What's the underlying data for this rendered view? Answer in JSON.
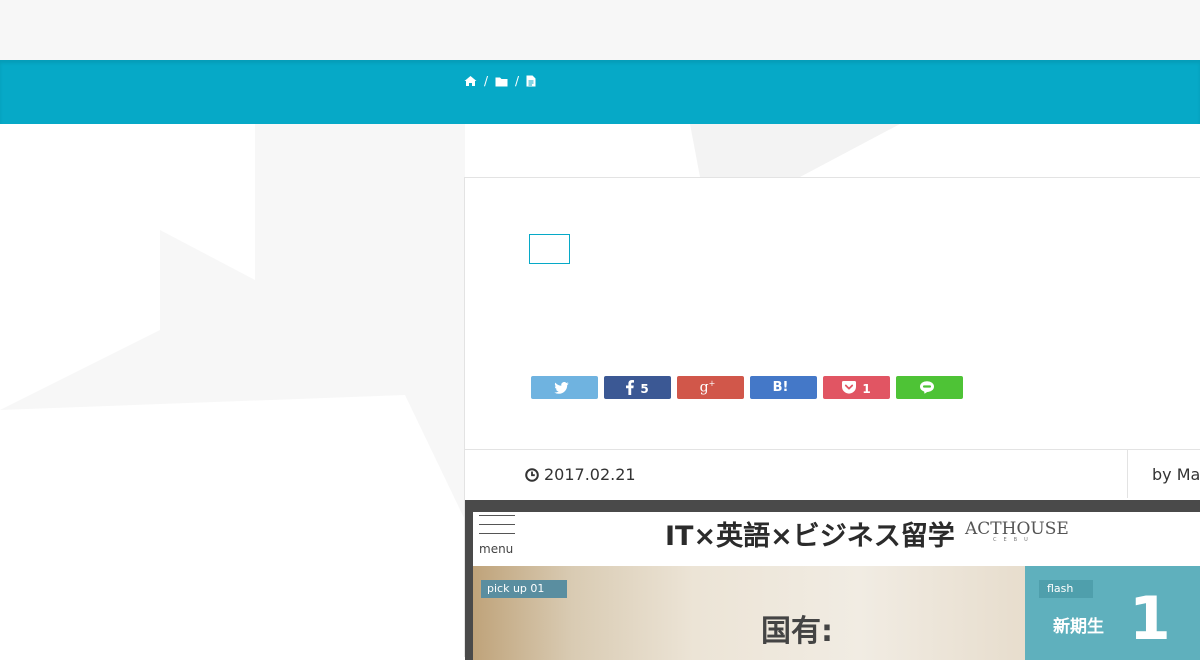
{
  "colors": {
    "accent": "#06a9c7",
    "card_border": "#e3e3e3"
  },
  "breadcrumb": {
    "items": [
      {
        "icon": "home-icon"
      },
      {
        "icon": "folder-icon"
      },
      {
        "icon": "document-icon"
      }
    ],
    "separator": "/"
  },
  "article": {
    "category_label": "",
    "share_buttons": [
      {
        "service": "twitter",
        "icon": "twitter-icon",
        "count": "",
        "color": "#6fb3e0"
      },
      {
        "service": "facebook",
        "icon": "facebook-icon",
        "count": "5",
        "color": "#3b5894"
      },
      {
        "service": "google-plus",
        "icon": "google-plus-icon",
        "count": "",
        "color": "#d1574a"
      },
      {
        "service": "hatena-bookmark",
        "icon": "hatena-bookmark-icon",
        "count": "",
        "color": "#4478c8"
      },
      {
        "service": "pocket",
        "icon": "pocket-icon",
        "count": "1",
        "color": "#e15563"
      },
      {
        "service": "line",
        "icon": "line-icon",
        "count": "",
        "color": "#4ec336"
      }
    ],
    "date": "2017.02.21",
    "author": "by Ma"
  },
  "hero_image": {
    "menu_label": "menu",
    "title": "IT×英語×ビジネス留学",
    "logo": "ACTHOUSE",
    "logo_sub": "CEBU",
    "pickup_label": "pick up 01",
    "photo_text": "国有:",
    "flash_label": "flash",
    "flash_text": "新期生",
    "flash_number": "1"
  }
}
